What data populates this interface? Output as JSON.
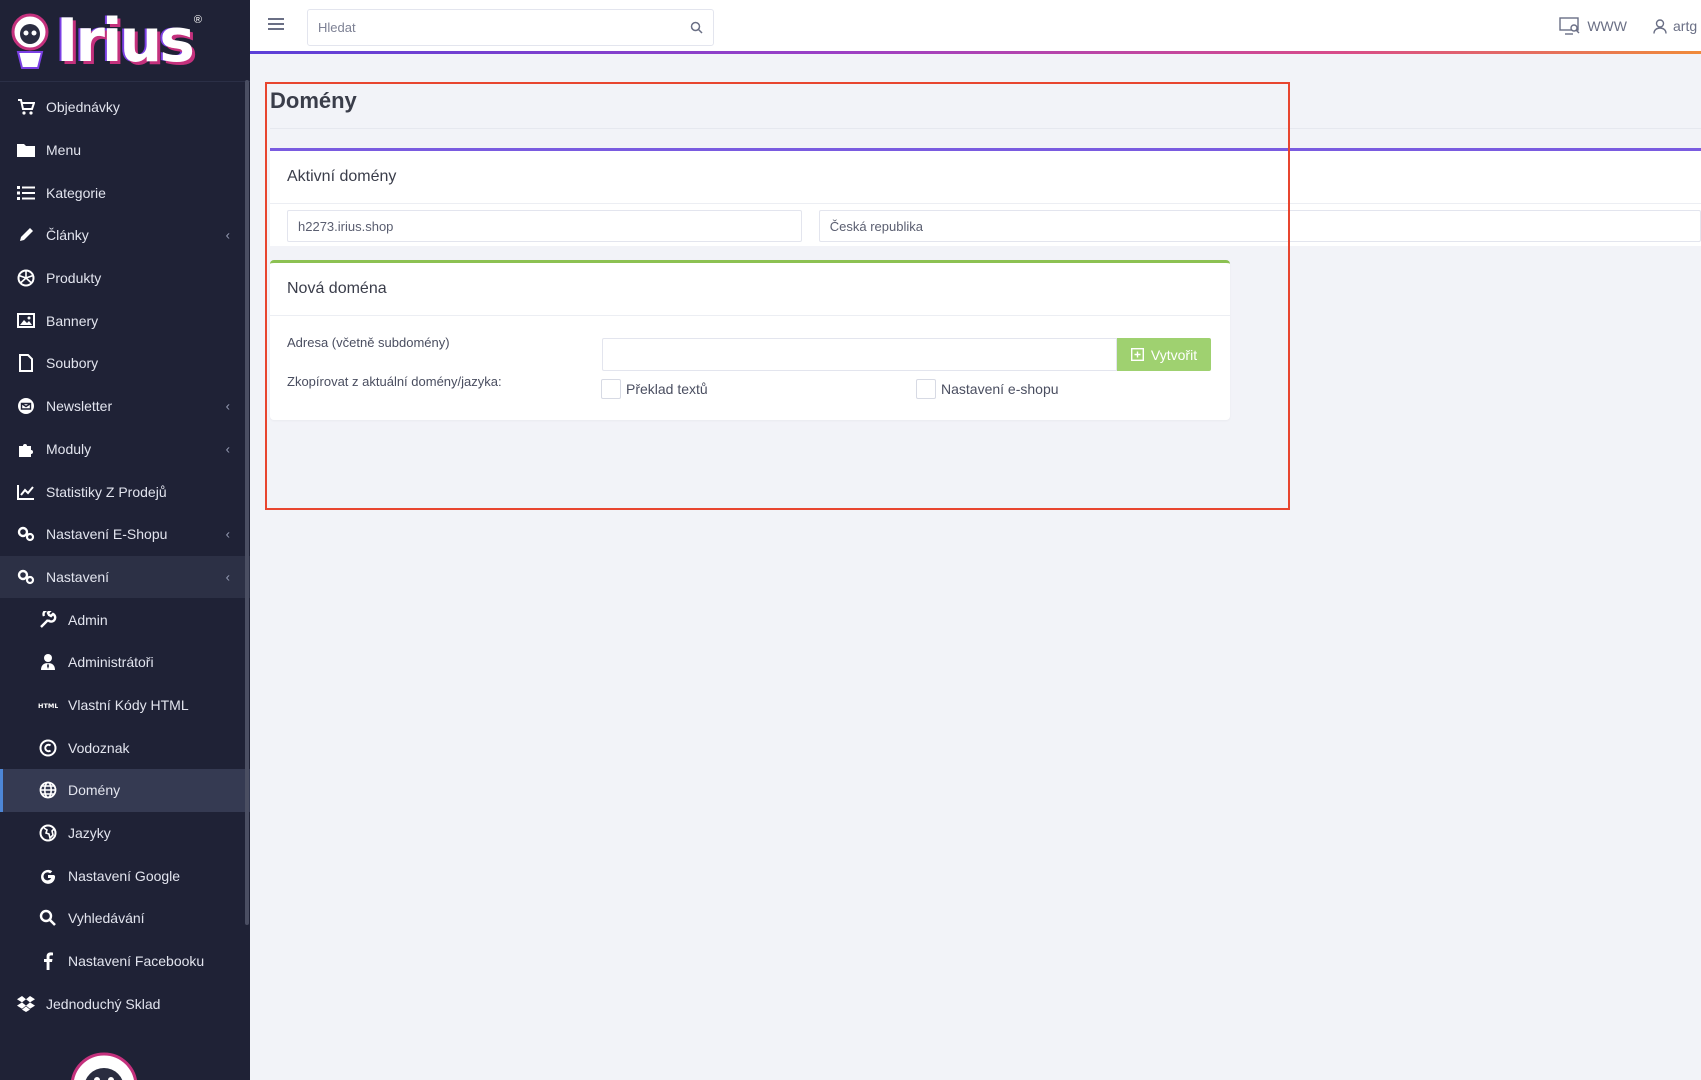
{
  "brand": {
    "name": "Irius",
    "reg_mark": "®"
  },
  "sidebar": {
    "items": [
      {
        "label": "Objednávky",
        "icon": "cart-icon"
      },
      {
        "label": "Menu",
        "icon": "folder-icon"
      },
      {
        "label": "Kategorie",
        "icon": "list-icon"
      },
      {
        "label": "Články",
        "icon": "pencil-icon",
        "expandable": true
      },
      {
        "label": "Produkty",
        "icon": "aperture-icon"
      },
      {
        "label": "Bannery",
        "icon": "image-icon"
      },
      {
        "label": "Soubory",
        "icon": "file-icon"
      },
      {
        "label": "Newsletter",
        "icon": "envelope-icon",
        "expandable": true
      },
      {
        "label": "Moduly",
        "icon": "puzzle-icon",
        "expandable": true
      },
      {
        "label": "Statistiky Z Prodejů",
        "icon": "line-chart-icon"
      },
      {
        "label": "Nastavení E-Shopu",
        "icon": "gears-icon",
        "expandable": true
      },
      {
        "label": "Nastavení",
        "icon": "gears-icon",
        "expandable": true,
        "open": true
      }
    ],
    "subitems": [
      {
        "label": "Admin",
        "icon": "wrench-icon"
      },
      {
        "label": "Administrátoři",
        "icon": "user-tie-icon"
      },
      {
        "label": "Vlastní Kódy HTML",
        "icon": "html-icon"
      },
      {
        "label": "Vodoznak",
        "icon": "copyright-icon"
      },
      {
        "label": "Domény",
        "icon": "globe-icon",
        "active": true
      },
      {
        "label": "Jazyky",
        "icon": "globe-europe-icon"
      },
      {
        "label": "Nastavení Google",
        "icon": "google-icon"
      },
      {
        "label": "Vyhledávání",
        "icon": "search-icon"
      },
      {
        "label": "Nastavení Facebooku",
        "icon": "facebook-icon"
      }
    ],
    "last_item": {
      "label": "Jednoduchý Sklad",
      "icon": "dropbox-icon"
    },
    "chevron": "‹"
  },
  "topbar": {
    "search_placeholder": "Hledat",
    "www_label": "WWW",
    "user_label": "artg"
  },
  "page": {
    "title": "Domény",
    "active_card": {
      "title": "Aktivní domény",
      "domain": "h2273.irius.shop",
      "country": "Česká republika"
    },
    "new_card": {
      "title": "Nová doména",
      "address_label": "Adresa (včetně subdomény)",
      "address_value": "",
      "create_button": "Vytvořit",
      "copy_label": "Zkopírovat z aktuální domény/jazyka:",
      "check_texts": "Překlad textů",
      "check_eshop": "Nastavení e-shopu"
    }
  },
  "colors": {
    "sidebar_bg": "#1f2236",
    "accent_purple": "#7a5be0",
    "accent_green": "#8cc152",
    "button_green": "#9fd170",
    "highlight_red": "#e8452f"
  }
}
